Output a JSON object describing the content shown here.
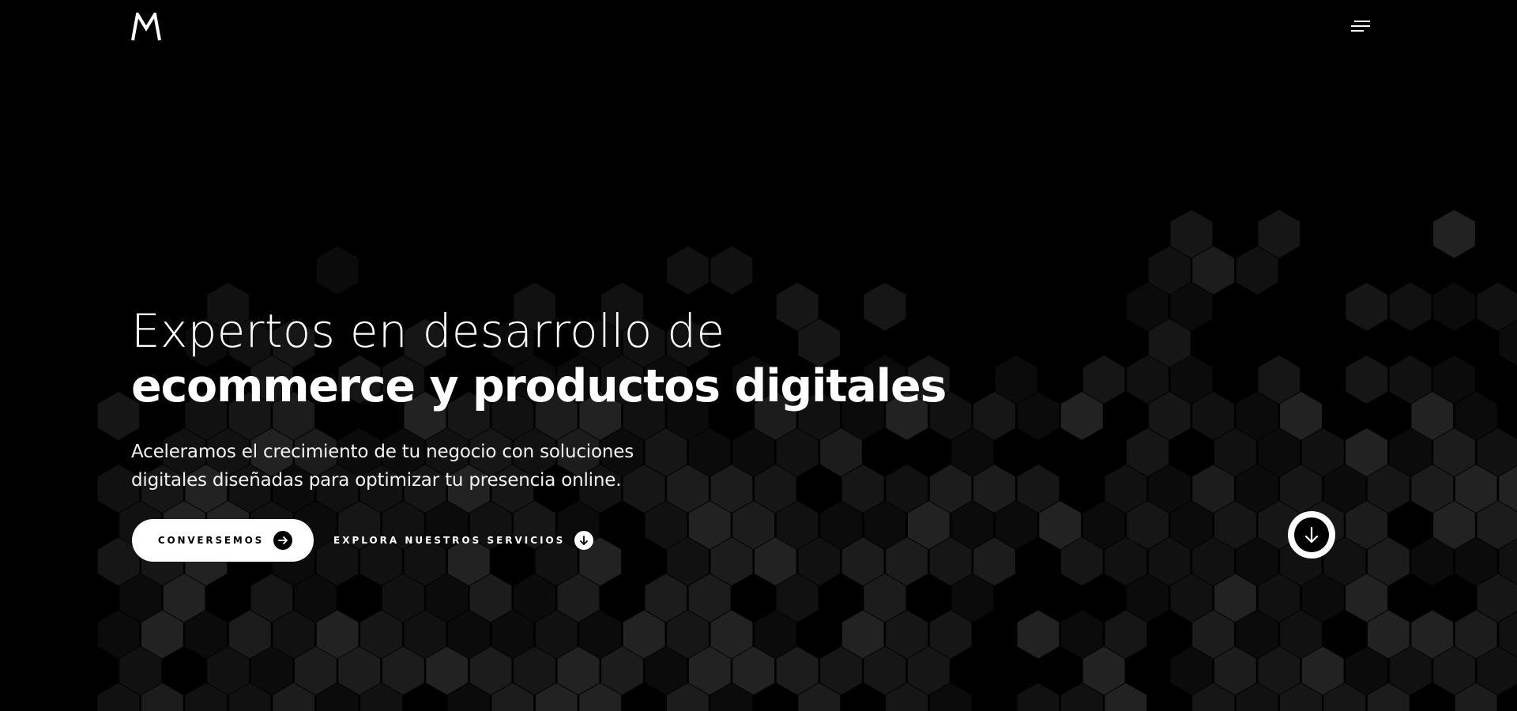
{
  "header": {
    "logo_alt": "M",
    "menu_label": "Menu"
  },
  "hero": {
    "title_line1": "Expertos en desarrollo de",
    "title_line2": "ecommerce y productos digitales",
    "subtitle_line1": "Aceleramos el crecimiento de tu negocio con soluciones",
    "subtitle_line2": "digitales diseñadas para optimizar tu presencia online."
  },
  "actions": {
    "primary_label": "CONVERSEMOS",
    "primary_icon": "arrow-right-icon",
    "secondary_label": "EXPLORA NUESTROS SERVICIOS",
    "secondary_icon": "arrow-down-icon",
    "scroll_icon": "arrow-down-icon"
  },
  "theme": {
    "background": "#000000",
    "foreground": "#ffffff",
    "hex_colors": [
      "#0b0b0b",
      "#111111",
      "#161616",
      "#1c1c1c",
      "#222222"
    ]
  }
}
